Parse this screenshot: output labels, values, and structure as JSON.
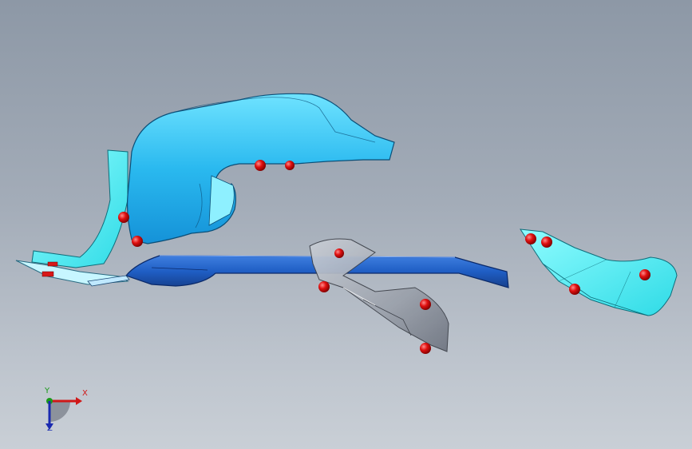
{
  "viewport": {
    "background_top": "#8d98a6",
    "background_bottom": "#c9cfd6"
  },
  "colors": {
    "cyan_part": "#29b8ee",
    "cyan_light": "#5fdcff",
    "aqua_part": "#3ee6ee",
    "blue_plate": "#1f5ec4",
    "gray_part": "#9aa0aa",
    "contact_point": "#e01010"
  },
  "triad": {
    "x_label": "X",
    "y_label": "Y",
    "z_label": "Z",
    "x_color": "#d01818",
    "y_color": "#1a9a1a",
    "z_color": "#1a2ab0"
  }
}
